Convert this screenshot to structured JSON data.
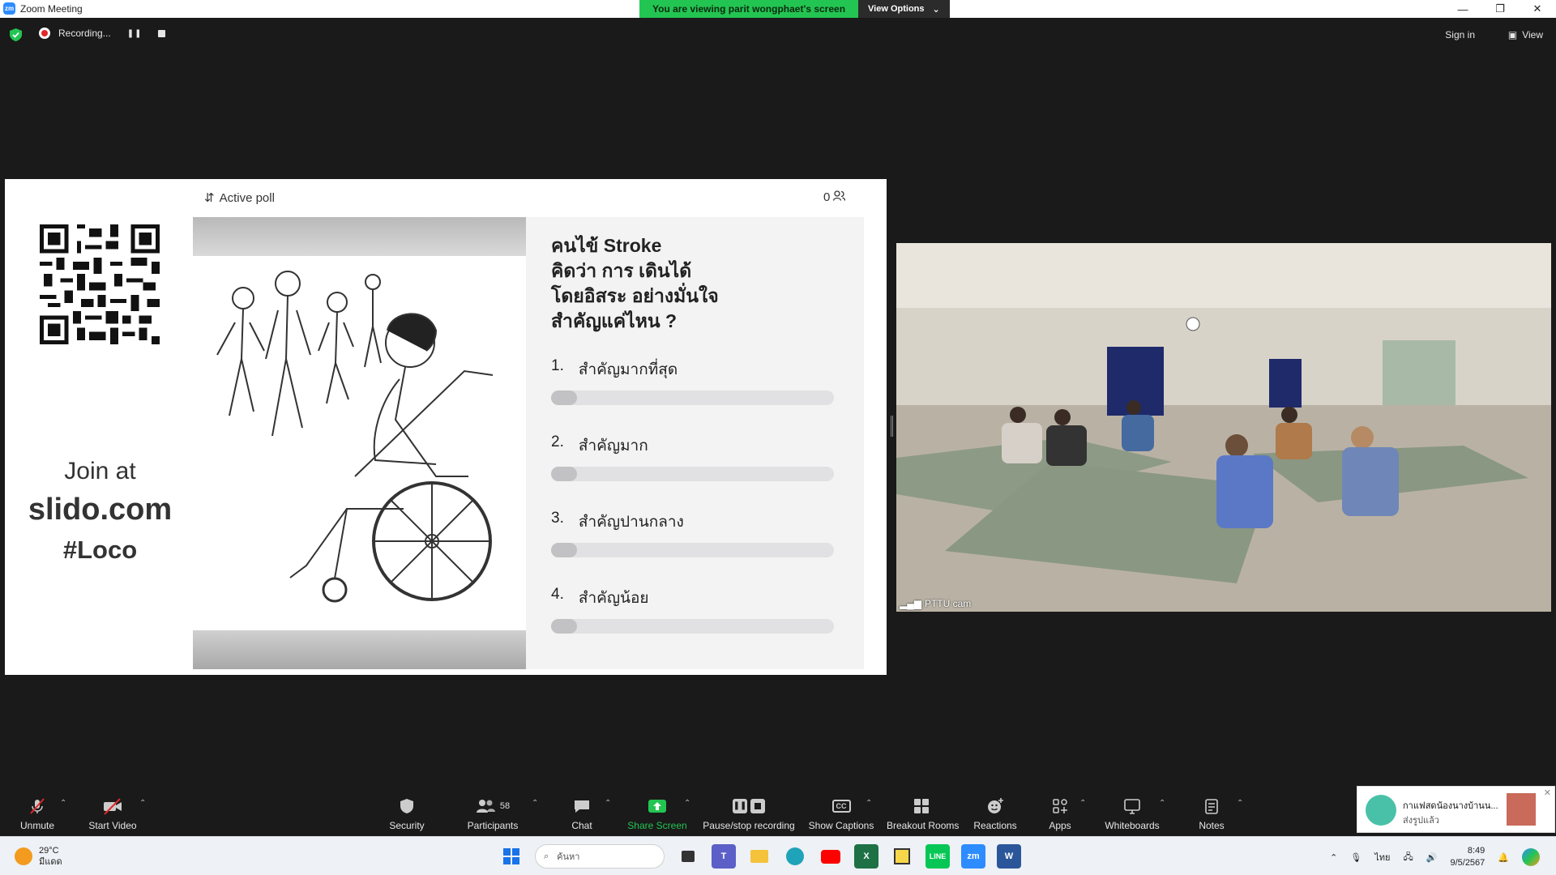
{
  "window": {
    "title": "Zoom Meeting"
  },
  "viewing_banner": {
    "message": "You are viewing parit wongphaet's screen",
    "options_label": "View Options"
  },
  "top_strip": {
    "recording_label": "Recording...",
    "signin_label": "Sign in",
    "view_label": "View"
  },
  "shared_screen": {
    "join_line1": "Join at",
    "join_line2": "slido.com",
    "join_line3": "#Loco",
    "poll_header": "Active poll",
    "participant_count": "0",
    "question_lines": [
      "คนไข้ Stroke",
      "คิดว่า การ เดินได้",
      "โดยอิสระ อย่างมั่นใจ",
      "สำคัญแค่ไหน ?"
    ],
    "options": [
      {
        "number": "1.",
        "label": "สำคัญมากที่สุด",
        "progress": 0.0
      },
      {
        "number": "2.",
        "label": "สำคัญมาก",
        "progress": 0.0
      },
      {
        "number": "3.",
        "label": "สำคัญปานกลาง",
        "progress": 0.0
      },
      {
        "number": "4.",
        "label": "สำคัญน้อย",
        "progress": 0.0
      }
    ]
  },
  "camera": {
    "label": "PTTU cam"
  },
  "toolbar": {
    "unmute": "Unmute",
    "start_video": "Start Video",
    "security": "Security",
    "participants": "Participants",
    "participants_count": "58",
    "chat": "Chat",
    "share_screen": "Share Screen",
    "pause_recording": "Pause/stop recording",
    "show_captions": "Show Captions",
    "breakout_rooms": "Breakout Rooms",
    "reactions": "Reactions",
    "apps": "Apps",
    "whiteboards": "Whiteboards",
    "notes": "Notes"
  },
  "notification": {
    "title": "กาแฟสดน้องนางบ้านน...",
    "subtitle": "ส่งรูปแล้ว"
  },
  "taskbar": {
    "temperature": "29°C",
    "weather_desc": "มีแดด",
    "search_placeholder": "ค้นหา",
    "language": "ไทย",
    "time": "8:49",
    "date": "9/5/2567"
  },
  "colors": {
    "share_green": "#23c552",
    "zoom_blue": "#2d8cff",
    "recording_red": "#e02828"
  }
}
